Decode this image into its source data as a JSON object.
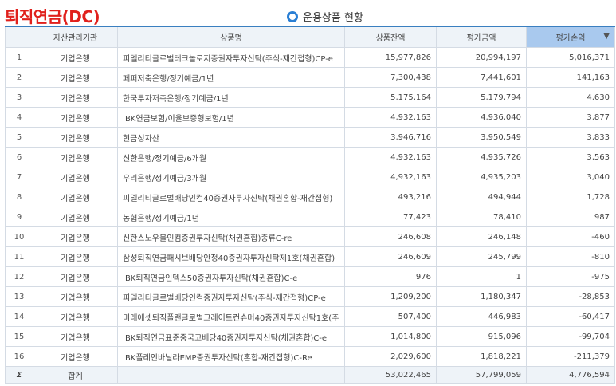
{
  "page": {
    "title": "퇴직연금(DC)",
    "subtitle": "운용상품 현황"
  },
  "table": {
    "headers": {
      "org": "자산관리기관",
      "product": "상품명",
      "balance": "상품잔액",
      "valuation": "평가금액",
      "profit": "평가손익"
    },
    "rows": [
      {
        "idx": "1",
        "org": "기업은행",
        "product": "피델리티글로벌테크놀로지증권자투자신탁(주식-재간접형)CP-e",
        "balance": "15,977,826",
        "valuation": "20,994,197",
        "profit": "5,016,371"
      },
      {
        "idx": "2",
        "org": "기업은행",
        "product": "페퍼저축은행/정기예금/1년",
        "balance": "7,300,438",
        "valuation": "7,441,601",
        "profit": "141,163"
      },
      {
        "idx": "3",
        "org": "기업은행",
        "product": "한국투자저축은행/정기예금/1년",
        "balance": "5,175,164",
        "valuation": "5,179,794",
        "profit": "4,630"
      },
      {
        "idx": "4",
        "org": "기업은행",
        "product": "IBK연금보험/이율보증형보험/1년",
        "balance": "4,932,163",
        "valuation": "4,936,040",
        "profit": "3,877"
      },
      {
        "idx": "5",
        "org": "기업은행",
        "product": "현금성자산",
        "balance": "3,946,716",
        "valuation": "3,950,549",
        "profit": "3,833"
      },
      {
        "idx": "6",
        "org": "기업은행",
        "product": "신한은행/정기예금/6개월",
        "balance": "4,932,163",
        "valuation": "4,935,726",
        "profit": "3,563"
      },
      {
        "idx": "7",
        "org": "기업은행",
        "product": "우리은행/정기예금/3개월",
        "balance": "4,932,163",
        "valuation": "4,935,203",
        "profit": "3,040"
      },
      {
        "idx": "8",
        "org": "기업은행",
        "product": "피델리티글로벌배당인컴40증권자투자신탁(채권혼합-재간접형)",
        "balance": "493,216",
        "valuation": "494,944",
        "profit": "1,728"
      },
      {
        "idx": "9",
        "org": "기업은행",
        "product": "농협은행/정기예금/1년",
        "balance": "77,423",
        "valuation": "78,410",
        "profit": "987"
      },
      {
        "idx": "10",
        "org": "기업은행",
        "product": "신한스노우볼인컴증권투자신탁(채권혼합)종류C-re",
        "balance": "246,608",
        "valuation": "246,148",
        "profit": "-460"
      },
      {
        "idx": "11",
        "org": "기업은행",
        "product": "삼성퇴직연금패시브배당안정40증권자투자신탁제1호(채권혼합)",
        "balance": "246,609",
        "valuation": "245,799",
        "profit": "-810"
      },
      {
        "idx": "12",
        "org": "기업은행",
        "product": "IBK퇴직연금인덱스50증권자투자신탁(채권혼합)C-e",
        "balance": "976",
        "valuation": "1",
        "profit": "-975"
      },
      {
        "idx": "13",
        "org": "기업은행",
        "product": "피델리티글로벌배당인컴증권자투자신탁(주식-재간접형)CP-e",
        "balance": "1,209,200",
        "valuation": "1,180,347",
        "profit": "-28,853"
      },
      {
        "idx": "14",
        "org": "기업은행",
        "product": "미래에셋퇴직플랜글로벌그레이트컨슈머40증권자투자신탁1호(주",
        "balance": "507,400",
        "valuation": "446,983",
        "profit": "-60,417"
      },
      {
        "idx": "15",
        "org": "기업은행",
        "product": "IBK퇴직연금표준중국고배당40증권자투자신탁(채권혼합)C-e",
        "balance": "1,014,800",
        "valuation": "915,096",
        "profit": "-99,704"
      },
      {
        "idx": "16",
        "org": "기업은행",
        "product": "IBK플레인바닐라EMP증권투자신탁(혼합-재간접형)C-Re",
        "balance": "2,029,600",
        "valuation": "1,818,221",
        "profit": "-211,379"
      }
    ],
    "footer": {
      "sigma": "Σ",
      "label": "합계",
      "balance": "53,022,465",
      "valuation": "57,799,059",
      "profit": "4,776,594"
    }
  },
  "icons": {
    "bullet": "bullet-circle-icon",
    "sort": "sort-desc-icon"
  },
  "colors": {
    "title": "#e0201c",
    "accent": "#2a7fd4",
    "header_bg": "#eef3f8",
    "sorted_header_bg": "#a9c9ee"
  }
}
